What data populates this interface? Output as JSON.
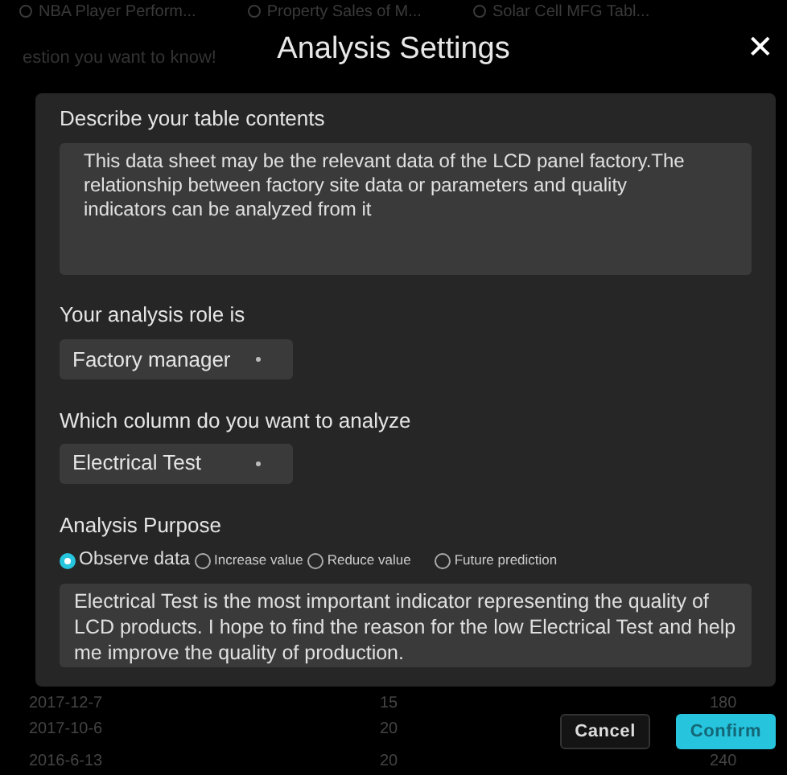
{
  "background": {
    "tabs": [
      "NBA Player Perform...",
      "Property Sales of M...",
      "Solar Cell MFG Tabl..."
    ],
    "prompt": "estion you want to know!",
    "rows": [
      [
        "2017-12-7",
        "15",
        "180"
      ],
      [
        "2017-10-6",
        "20"
      ],
      [
        "2016-6-13",
        "20",
        "240"
      ]
    ]
  },
  "dialog": {
    "title": "Analysis Settings",
    "close": "✕",
    "description": {
      "label": "Describe your table contents",
      "value": "This data sheet may be the relevant data of the LCD panel factory.The relationship between factory site data or parameters and quality indicators can be analyzed from it"
    },
    "role": {
      "label": "Your analysis role is",
      "value": "Factory manager"
    },
    "column": {
      "label": "Which column do you want to analyze",
      "value": "Electrical Test"
    },
    "purpose": {
      "label": "Analysis Purpose",
      "options": [
        {
          "label": "Observe data",
          "selected": true
        },
        {
          "label": "Increase  value",
          "selected": false
        },
        {
          "label": "Reduce value",
          "selected": false
        },
        {
          "label": "Future prediction",
          "selected": false
        }
      ],
      "value": "Electrical Test is the most important indicator representing the quality of LCD products. I hope to find the reason for the low Electrical Test and help me improve the quality of production."
    },
    "buttons": {
      "cancel": "Cancel",
      "confirm": "Confirm"
    }
  }
}
